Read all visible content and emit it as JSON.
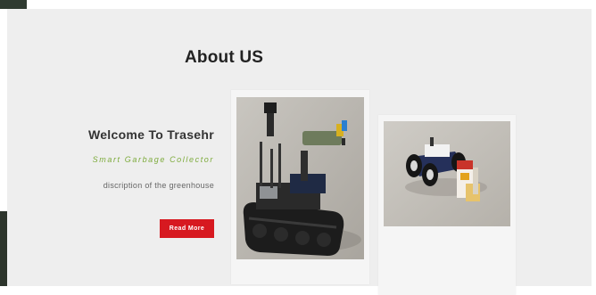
{
  "about": {
    "title": "About US",
    "welcome_heading": "Welcome To Trasehr",
    "tagline": "Smart Garbage Collector",
    "description": "discription of the greenhouse",
    "read_more_label": "Read More"
  },
  "gallery": {
    "images": [
      {
        "subject": "tracked-robot-with-arm"
      },
      {
        "subject": "wheeled-robot-with-boxes"
      }
    ]
  },
  "colors": {
    "accent_button": "#d71920",
    "tagline_green": "#7dab3c",
    "section_bg": "#eeeeee",
    "card_bg": "#f5f5f5"
  }
}
